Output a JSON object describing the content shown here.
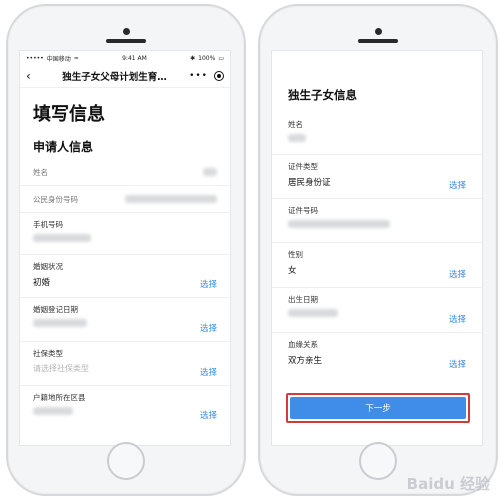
{
  "left_phone": {
    "status_bar": {
      "carrier": "中国移动",
      "time": "9:41 AM",
      "battery": "100%"
    },
    "nav": {
      "back_icon": "chevron-left-icon",
      "title": "独生子女父母计划生育…",
      "more": "•••"
    },
    "page_title": "填写信息",
    "section_title": "申请人信息",
    "fields": [
      {
        "label": "姓名"
      },
      {
        "label": "公民身份号码"
      },
      {
        "label": "手机号码"
      },
      {
        "label": "婚姻状况",
        "value": "初婚",
        "action": "选择"
      },
      {
        "label": "婚姻登记日期",
        "action": "选择"
      },
      {
        "label": "社保类型",
        "placeholder": "请选择社保类型",
        "action": "选择"
      },
      {
        "label": "户籍地所在区县",
        "action": "选择"
      }
    ]
  },
  "right_phone": {
    "page_title": "独生子女信息",
    "fields": [
      {
        "label": "姓名"
      },
      {
        "label": "证件类型",
        "value": "居民身份证",
        "action": "选择"
      },
      {
        "label": "证件号码"
      },
      {
        "label": "性别",
        "value": "女",
        "action": "选择"
      },
      {
        "label": "出生日期",
        "action": "选择"
      },
      {
        "label": "血缘关系",
        "value": "双方亲生",
        "action": "选择"
      }
    ],
    "next_button": "下一步"
  },
  "watermark": "Baidu 经验",
  "colors": {
    "accent": "#3a8ee6",
    "button": "#3f8de8",
    "highlight": "#d6393c"
  }
}
